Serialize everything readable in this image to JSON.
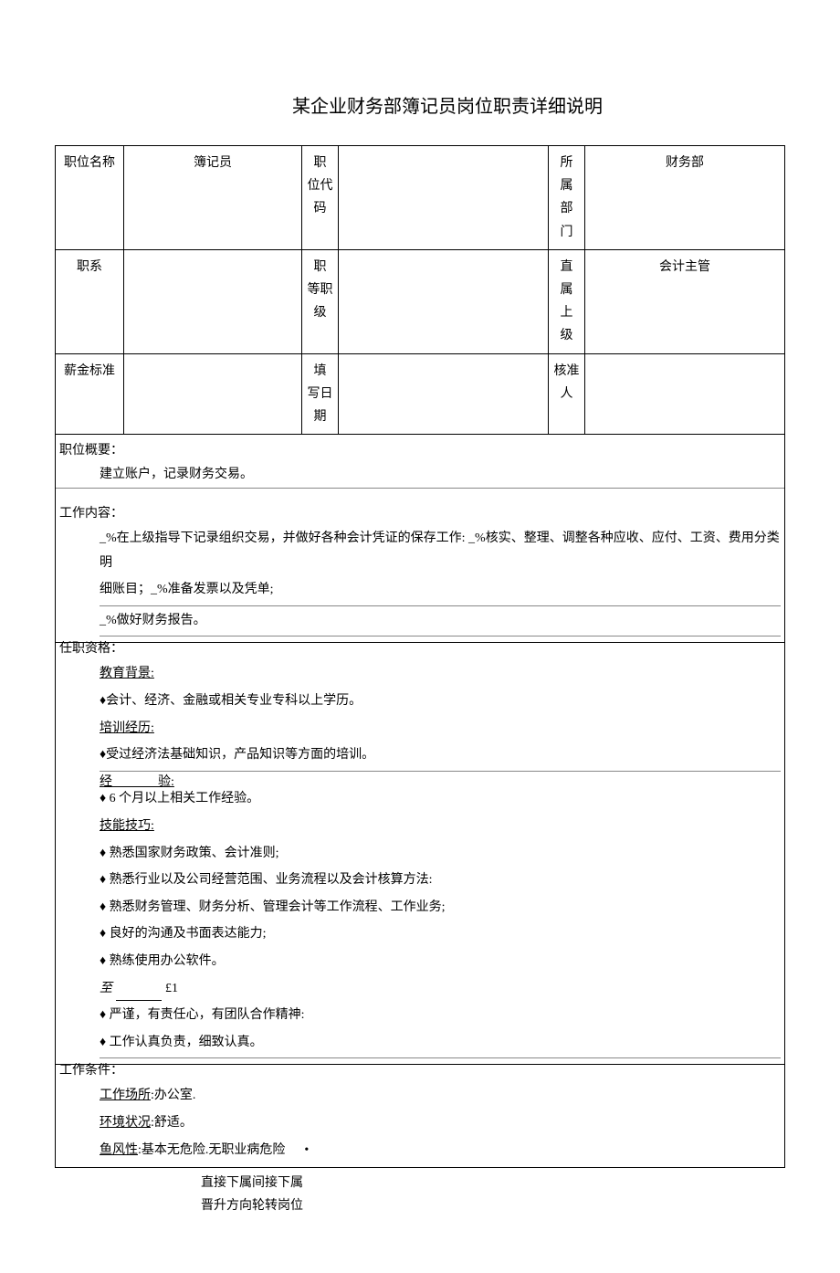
{
  "title": "某企业财务部簿记员岗位职责详细说明",
  "header": {
    "row1": {
      "label1": "职位名称",
      "val1": "簿记员",
      "label2": "职\n位代\n码",
      "val2": "",
      "label3": "所\n属\n部\n门",
      "val3": "财务部"
    },
    "row2": {
      "label1": "职系",
      "val1": "",
      "label2": "职\n等职\n级",
      "val2": "",
      "label3": "直\n属\n上\n级",
      "val3": "会计主管"
    },
    "row3": {
      "label1": "薪金标准",
      "val1": "",
      "label2": "填\n写日\n期",
      "val2": "",
      "label3": "核准\n人",
      "val3": ""
    }
  },
  "overview": {
    "title": "职位概要：",
    "content": "建立账户，记录财务交易。"
  },
  "workContent": {
    "title": "工作内容：",
    "line1": "_%在上级指导下记录组织交易，并做好各种会计凭证的保存工作:  _%核实、整理、调整各种应收、应付、工资、费用分类明",
    "line2": "细账目；_%准备发票以及凭单;",
    "line3": "_%做好财务报告。"
  },
  "qualification": {
    "title": "任职资格：",
    "eduTitle": "教育背景:",
    "edu1": "♦会计、经济、金融或相关专业专科以上学历。",
    "trainTitle": "培训经历:",
    "train1": "♦受过经济法基础知识，产品知识等方面的培训。",
    "expTitle": "经",
    "expTitle2": "验:",
    "exp1": "♦ 6 个月以上相关工作经验。",
    "skillTitle": "技能技巧:",
    "skill1": "♦ 熟悉国家财务政策、会计准则;",
    "skill2": "♦ 熟悉行业以及公司经营范围、业务流程以及会计核算方法:",
    "skill3": "♦ 熟悉财务管理、财务分析、管理会计等工作流程、工作业务;",
    "skill4": "♦ 良好的沟通及书面表达能力;",
    "skill5": "♦ 熟练使用办公软件。",
    "attTitle1": "至",
    "attTitle2": "£1",
    "att1": "♦ 严谨，有责任心，有团队合作精神:",
    "att2": "♦ 工作认真负责，细致认真。"
  },
  "workCondition": {
    "title": "工作条件：",
    "placeLabel": "工作场所",
    "placeVal": ":办公室.",
    "envLabel": "环境状况",
    "envVal": ":舒适。",
    "riskLabel": "鱼风性",
    "riskVal": ":基本无危险.无职业病危险"
  },
  "footer": {
    "line1": "直接下属间接下属",
    "line2": "晋升方向轮转岗位"
  }
}
